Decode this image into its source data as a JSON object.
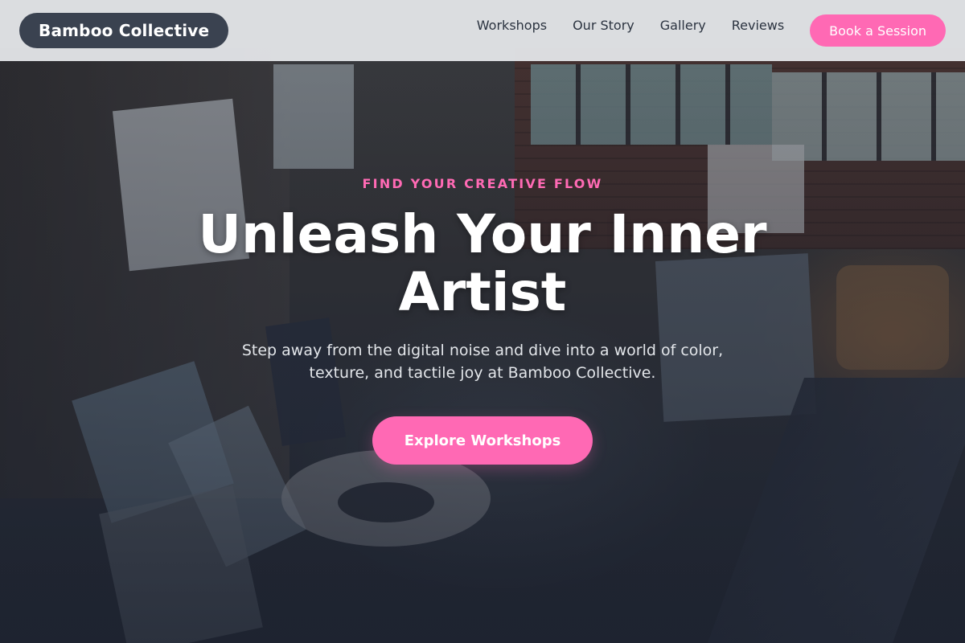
{
  "header": {
    "brand": "Bamboo Collective",
    "nav": [
      {
        "label": "Workshops"
      },
      {
        "label": "Our Story"
      },
      {
        "label": "Gallery"
      },
      {
        "label": "Reviews"
      }
    ],
    "cta_label": "Book a Session"
  },
  "hero": {
    "eyebrow": "FIND YOUR CREATIVE FLOW",
    "title": "Unleash Your Inner Artist",
    "subtitle": "Step away from the digital noise and dive into a world of color, texture, and tactile joy at Bamboo Collective.",
    "button_label": "Explore Workshops"
  },
  "colors": {
    "accent": "#ff69b4",
    "brand_bg": "#3a4250",
    "header_bg": "#e4e6e9",
    "overlay": "#1c2230"
  }
}
